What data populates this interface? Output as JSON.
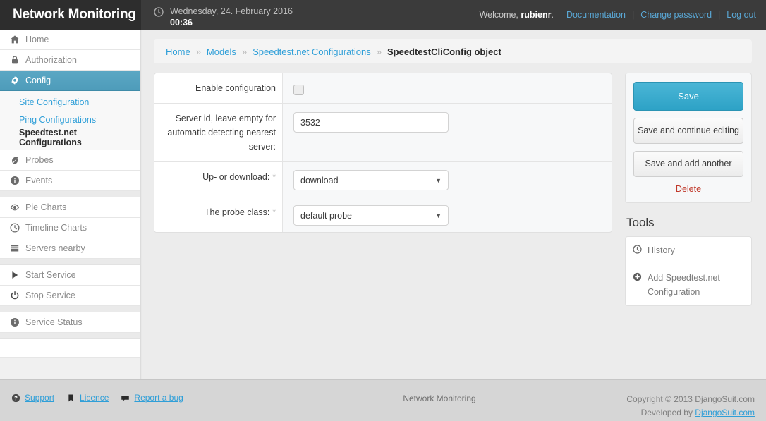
{
  "header": {
    "logo": "Network Monitoring",
    "clock_icon": "clock-icon",
    "date": "Wednesday, 24. February 2016",
    "time": "00:36",
    "welcome_prefix": "Welcome, ",
    "username": "rubienr",
    "welcome_suffix": ".",
    "links": [
      {
        "label": "Documentation"
      },
      {
        "label": "Change password"
      },
      {
        "label": "Log out"
      }
    ],
    "separator": "|"
  },
  "sidebar": {
    "items": [
      {
        "label": "Home",
        "icon": "home-icon"
      },
      {
        "label": "Authorization",
        "icon": "lock-icon"
      },
      {
        "label": "Config",
        "icon": "gear-icon",
        "active": true
      }
    ],
    "submenu": [
      {
        "label": "Site Configuration",
        "current": false
      },
      {
        "label": "Ping Configurations",
        "current": false
      },
      {
        "label": "Speedtest.net Configurations",
        "current": true
      }
    ],
    "items2": [
      {
        "label": "Probes",
        "icon": "leaf-icon"
      },
      {
        "label": "Events",
        "icon": "info-icon"
      }
    ],
    "items3": [
      {
        "label": "Pie Charts",
        "icon": "eye-icon"
      },
      {
        "label": "Timeline Charts",
        "icon": "clock-icon"
      },
      {
        "label": "Servers nearby",
        "icon": "list-icon"
      }
    ],
    "items4": [
      {
        "label": "Start Service",
        "icon": "play-icon"
      },
      {
        "label": "Stop Service",
        "icon": "power-icon"
      }
    ],
    "items5": [
      {
        "label": "Service Status",
        "icon": "info-icon"
      }
    ]
  },
  "breadcrumb": {
    "separator": "»",
    "items": [
      {
        "label": "Home",
        "current": false
      },
      {
        "label": "Models",
        "current": false
      },
      {
        "label": "Speedtest.net Configurations",
        "current": false
      },
      {
        "label": "SpeedtestCliConfig object",
        "current": true
      }
    ]
  },
  "form": {
    "rows": [
      {
        "label": "Enable configuration",
        "required": "",
        "type": "checkbox",
        "checked": false
      },
      {
        "label": "Server id, leave empty for automatic detecting nearest server:",
        "required": "",
        "type": "text",
        "value": "3532",
        "placeholder": ""
      },
      {
        "label": "Up- or download:",
        "required": "*",
        "type": "select",
        "value": "download",
        "caret": "▼"
      },
      {
        "label": "The probe class:",
        "required": "*",
        "type": "select",
        "value": "default probe",
        "caret": "▼"
      }
    ]
  },
  "actions": {
    "save": "Save",
    "save_continue": "Save and continue editing",
    "save_add_another": "Save and add another",
    "delete": "Delete"
  },
  "tools": {
    "title": "Tools",
    "items": [
      {
        "label": "History",
        "icon": "clock-icon"
      },
      {
        "label": "Add Speedtest.net Configuration",
        "icon": "plus-circle-icon"
      }
    ]
  },
  "footer": {
    "links": [
      {
        "label": "Support",
        "icon": "question-circle-icon"
      },
      {
        "label": "Licence",
        "icon": "bookmark-icon"
      },
      {
        "label": "Report a bug",
        "icon": "comment-icon"
      }
    ],
    "center": "Network Monitoring",
    "copyright": "Copyright © 2013 DjangoSuit.com",
    "developed_prefix": "Developed by ",
    "developed_link": "DjangoSuit.com"
  },
  "colors": {
    "accent": "#2da2c6",
    "link": "#2f9fd8",
    "delete": "#c0392b",
    "header_bg": "#3b3b3b",
    "logo_bg": "#2d2d2d"
  }
}
